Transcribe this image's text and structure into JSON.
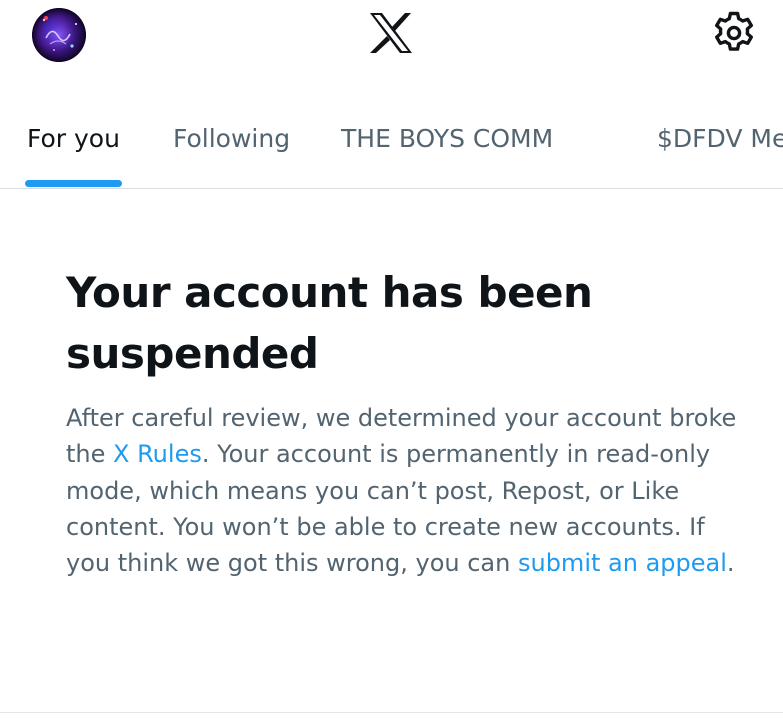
{
  "header": {
    "avatar_icon": "profile-avatar",
    "logo_icon": "x-logo",
    "settings_icon": "gear-icon"
  },
  "tabs": [
    {
      "label": "For you",
      "active": true
    },
    {
      "label": "Following",
      "active": false
    },
    {
      "label": "THE BOYS COMM",
      "active": false
    },
    {
      "label": "$DFDV Me",
      "active": false
    }
  ],
  "notice": {
    "title": "Your account has been suspended",
    "body_before_rules": "After careful review, we determined your account broke the ",
    "rules_link": "X Rules",
    "body_after_rules": ". Your account is permanently in read-only mode, which means you can’t post, Repost, or Like content. You won’t be able to create new accounts. If you think we got this wrong, you can ",
    "appeal_link": "submit an appeal",
    "body_end": "."
  },
  "colors": {
    "accent": "#1d9bf0",
    "text_primary": "#0f1419",
    "text_secondary": "#536471",
    "divider": "#d9dee2"
  }
}
